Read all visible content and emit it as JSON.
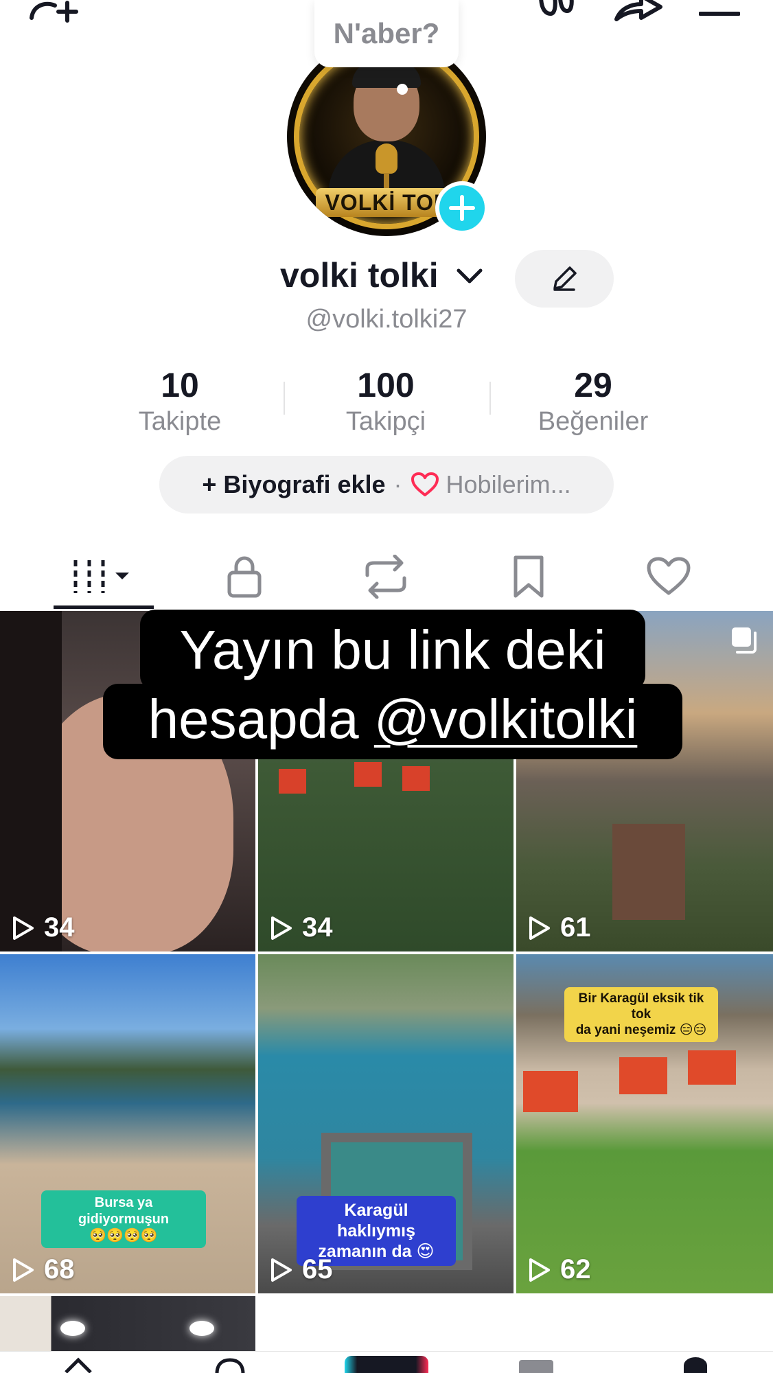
{
  "status_bubble": {
    "text": "N'aber?"
  },
  "avatar": {
    "banner_text": "VOLKİ TOL"
  },
  "profile": {
    "display_name": "volki tolki",
    "username": "@volki.tolki27"
  },
  "stats": [
    {
      "value": "10",
      "label": "Takipte"
    },
    {
      "value": "100",
      "label": "Takipçi"
    },
    {
      "value": "29",
      "label": "Beğeniler"
    }
  ],
  "bio": {
    "add_label": "+ Biyografi ekle",
    "separator": "·",
    "hobbies_label": "Hobilerim..."
  },
  "overlay_banner": {
    "line1": "Yayın bu link deki",
    "line2_prefix": "hesapda ",
    "line2_mention": "@volkitolki"
  },
  "videos": [
    {
      "views": "34"
    },
    {
      "views": "34"
    },
    {
      "views": "61"
    },
    {
      "views": "68",
      "caption": "Bursa ya gidiyormuşun\n🥺🥺🥺🥺"
    },
    {
      "views": "65",
      "caption": "Karagül haklıymış\nzamanın da 😍"
    },
    {
      "views": "62",
      "caption": "Bir Karagül eksik tik tok\nda yani neşemiz 😑😑"
    }
  ],
  "colors": {
    "accent_cyan": "#20d5ec",
    "text_primary": "#161823",
    "text_secondary": "#8a8b91",
    "pill_bg": "#f1f1f2",
    "heart_red": "#fe2c55"
  }
}
